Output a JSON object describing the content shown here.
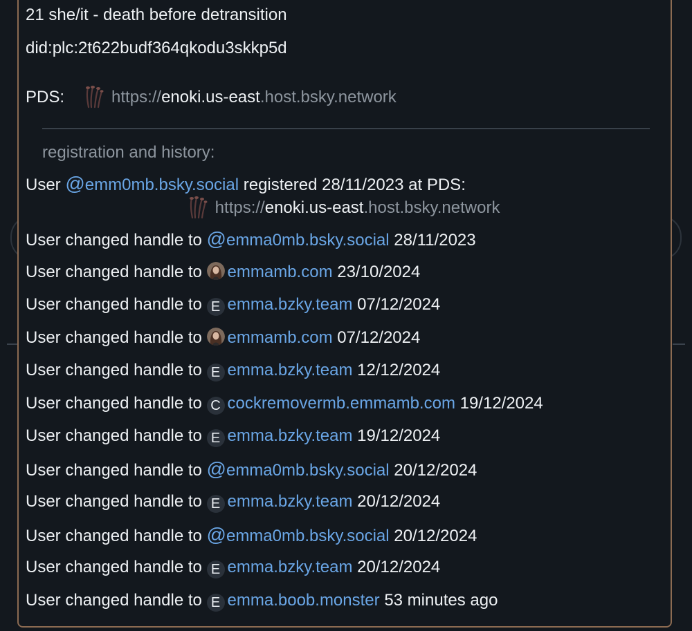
{
  "profile": {
    "bio": "21 she/it - death before detransition",
    "did": "did:plc:2t622budf364qkodu3skkp5d",
    "pds_label": "PDS:",
    "pds_url_prefix": "https://",
    "pds_url_host": "enoki.us-east",
    "pds_url_suffix": ".host.bsky.network"
  },
  "history": {
    "heading": "registration and history:",
    "registration": {
      "prefix": "User",
      "at": "@",
      "handle": "emm0mb.bsky.social",
      "verb": "registered",
      "date": "28/11/2023",
      "at_pds": "at PDS:",
      "pds_url_prefix": "https://",
      "pds_url_host": "enoki.us-east",
      "pds_url_suffix": ".host.bsky.network"
    },
    "change_label": "User changed handle to",
    "changes": [
      {
        "icon": "at",
        "badge": "@",
        "handle": "emma0mb.bsky.social",
        "when": "28/11/2023"
      },
      {
        "icon": "avatar",
        "badge": "",
        "handle": "emmamb.com",
        "when": "23/10/2024"
      },
      {
        "icon": "letter",
        "badge": "E",
        "handle": "emma.bzky.team",
        "when": "07/12/2024"
      },
      {
        "icon": "avatar",
        "badge": "",
        "handle": "emmamb.com",
        "when": "07/12/2024"
      },
      {
        "icon": "letter",
        "badge": "E",
        "handle": "emma.bzky.team",
        "when": "12/12/2024"
      },
      {
        "icon": "letter",
        "badge": "C",
        "handle": "cockremovermb.emmamb.com",
        "when": "19/12/2024"
      },
      {
        "icon": "letter",
        "badge": "E",
        "handle": "emma.bzky.team",
        "when": "19/12/2024"
      },
      {
        "icon": "at",
        "badge": "@",
        "handle": "emma0mb.bsky.social",
        "when": "20/12/2024"
      },
      {
        "icon": "letter",
        "badge": "E",
        "handle": "emma.bzky.team",
        "when": "20/12/2024"
      },
      {
        "icon": "at",
        "badge": "@",
        "handle": "emma0mb.bsky.social",
        "when": "20/12/2024"
      },
      {
        "icon": "letter",
        "badge": "E",
        "handle": "emma.bzky.team",
        "when": "20/12/2024"
      },
      {
        "icon": "letter",
        "badge": "E",
        "handle": "emma.boob.monster",
        "when": "53 minutes ago"
      }
    ]
  },
  "colors": {
    "background": "#13181e",
    "panel_border": "#8c6b52",
    "link": "#6aa6e6",
    "muted": "#8d959e",
    "text": "#eef1f4"
  }
}
